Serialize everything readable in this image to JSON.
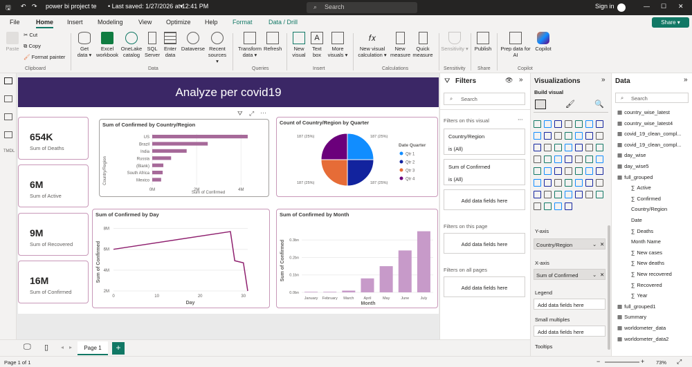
{
  "titlebar": {
    "file_title": "power bi project te",
    "saved": "• Last saved: 1/27/2026 at 12:41 PM",
    "search": "Search",
    "sign_in": "Sign in"
  },
  "menu": {
    "items": [
      "File",
      "Home",
      "Insert",
      "Modeling",
      "View",
      "Optimize",
      "Help",
      "Format",
      "Data / Drill"
    ],
    "share": "Share"
  },
  "ribbon": {
    "paste": "Paste",
    "cut": "Cut",
    "copy": "Copy",
    "format_painter": "Format painter",
    "clipboard": "Clipboard",
    "get_data": "Get data",
    "excel": "Excel workbook",
    "onelake": "OneLake catalog",
    "sql": "SQL Server",
    "enter_data": "Enter data",
    "dataverse": "Dataverse",
    "recent": "Recent sources",
    "data_group": "Data",
    "transform": "Transform data",
    "refresh": "Refresh",
    "queries_group": "Queries",
    "new_visual": "New visual",
    "text_box": "Text box",
    "more_visuals": "More visuals",
    "insert_group": "Insert",
    "new_visual_calc": "New visual calculation",
    "new_measure": "New measure",
    "quick_measure": "Quick measure",
    "calc_group": "Calculations",
    "sensitivity": "Sensitivity",
    "sens_group": "Sensitivity",
    "publish": "Publish",
    "share_group": "Share",
    "prep_ai": "Prep data for AI",
    "copilot": "Copilot",
    "copilot_group": "Copilot"
  },
  "report": {
    "title": "Analyze per covid19",
    "cards": [
      {
        "value": "654K",
        "label": "Sum of Deaths"
      },
      {
        "value": "6M",
        "label": "Sum of Active"
      },
      {
        "value": "9M",
        "label": "Sum of Recovered"
      },
      {
        "value": "16M",
        "label": "Sum of Confirmed"
      }
    ]
  },
  "charts": {
    "bar": {
      "title": "Sum of Confirmed by Country/Region",
      "ylabel": "Country/Region",
      "xlabel": "Sum of Confirmed"
    },
    "pie": {
      "title": "Count of Country/Region by Quarter",
      "legend_title": "Date Quarter"
    },
    "line": {
      "title": "Sum of Confirmed by Day",
      "ylabel": "Sum of Confirmed",
      "xlabel": "Day"
    },
    "col": {
      "title": "Sum of Confirmed by Month",
      "ylabel": "Sum of Confirmed",
      "xlabel": "Month"
    }
  },
  "chart_data": [
    {
      "type": "bar",
      "categories": [
        "US",
        "Brazil",
        "India",
        "Russia",
        "(Blank)",
        "South Africa",
        "Mexico"
      ],
      "values": [
        4300000,
        2500000,
        1550000,
        850000,
        500000,
        470000,
        400000
      ],
      "xticks": [
        "0M",
        "2M",
        "4M"
      ],
      "xlim": [
        0,
        4800000
      ]
    },
    {
      "type": "pie",
      "categories": [
        "Qtr 1",
        "Qtr 2",
        "Qtr 3",
        "Qtr 4"
      ],
      "values": [
        187,
        187,
        187,
        187
      ],
      "labels": [
        "187 (25%)",
        "187 (25%)",
        "187 (25%)",
        "187 (25%)"
      ],
      "colors": [
        "#118dff",
        "#12239e",
        "#e66c37",
        "#6b007b"
      ]
    },
    {
      "type": "line",
      "x": [
        0,
        27,
        28,
        30,
        31
      ],
      "y": [
        6000000,
        7700000,
        4900000,
        4700000,
        2000000
      ],
      "xticks": [
        "0",
        "10",
        "20",
        "30"
      ],
      "yticks": [
        "8M",
        "6M",
        "4M",
        "2M"
      ],
      "ylim": [
        2000000,
        8500000
      ],
      "xlim": [
        0,
        31
      ]
    },
    {
      "type": "bar",
      "categories": [
        "January",
        "February",
        "March",
        "April",
        "May",
        "June",
        "July"
      ],
      "values": [
        0,
        0,
        10000000,
        80000000,
        150000000,
        240000000,
        350000000
      ],
      "yticks": [
        "0.0bn",
        "0.1bn",
        "0.2bn",
        "0.3bn"
      ],
      "ylim": [
        0,
        380000000
      ]
    }
  ],
  "filters": {
    "title": "Filters",
    "search": "Search",
    "on_visual": "Filters on this visual",
    "f1_name": "Country/Region",
    "f1_val": "is (All)",
    "f2_name": "Sum of Confirmed",
    "f2_val": "is (All)",
    "add": "Add data fields here",
    "on_page": "Filters on this page",
    "all_pages": "Filters on all pages"
  },
  "viz": {
    "title": "Visualizations",
    "build": "Build visual",
    "yaxis": "Y-axis",
    "y_field": "Country/Region",
    "xaxis": "X-axis",
    "x_field": "Sum of Confirmed",
    "legend": "Legend",
    "add": "Add data fields here",
    "small": "Small multiples",
    "tooltips": "Tooltips"
  },
  "data": {
    "title": "Data",
    "search": "Search",
    "tables": [
      "country_wise_latest",
      "country_wise_latest4",
      "covid_19_clean_compl...",
      "covid_19_clean_compl...",
      "day_wise",
      "day_wise5",
      "full_grouped"
    ],
    "fields": [
      "Active",
      "Confirmed",
      "Country/Region",
      "Date",
      "Deaths",
      "Month Name",
      "New cases",
      "New deaths",
      "New recovered",
      "Recovered",
      "Year"
    ],
    "tables2": [
      "full_grouped1",
      "Summary",
      "worldometer_data",
      "worldometer_data2"
    ]
  },
  "bottom": {
    "page_tab": "Page 1",
    "status": "Page 1 of 1",
    "zoom": "73%"
  }
}
